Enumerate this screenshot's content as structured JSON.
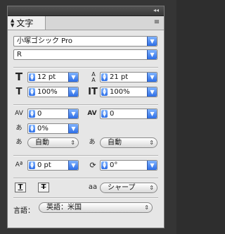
{
  "panel": {
    "tab_title": "文字",
    "collapse_icon": "◂◂",
    "menu_icon": "≡"
  },
  "font": {
    "family": "小塚ゴシック Pro",
    "style": "R"
  },
  "metrics": {
    "font_size": "12 pt",
    "leading": "21 pt",
    "vertical_scale": "100%",
    "horizontal_scale": "100%",
    "kerning": "0",
    "tracking": "0",
    "tsume": "0%",
    "aki_before": "自動",
    "aki_after": "自動",
    "baseline_shift": "0 pt",
    "rotation": "0°"
  },
  "options": {
    "antialias": "シャープ",
    "language_label": "言語：",
    "language_value": "英語：米国"
  }
}
